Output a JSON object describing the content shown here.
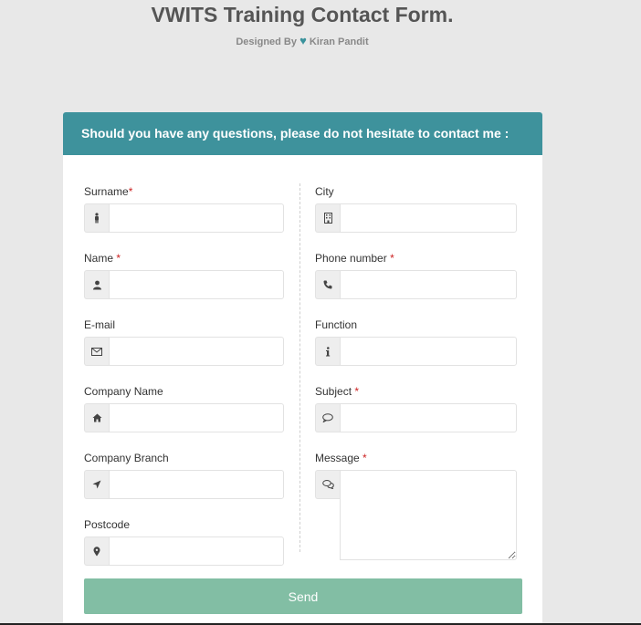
{
  "title": "VWITS Training Contact Form.",
  "subtitle": {
    "prefix": "Designed By",
    "heart_icon": "heart-icon",
    "author": "Kiran Pandit"
  },
  "form": {
    "header": "Should you have any questions, please do not hesitate to contact me :",
    "left_fields": [
      {
        "label": "Surname",
        "required": "*",
        "icon": "person-icon",
        "value": ""
      },
      {
        "label": "Name ",
        "required": "*",
        "icon": "user-icon",
        "value": ""
      },
      {
        "label": "E-mail",
        "required": "",
        "icon": "envelope-icon",
        "value": ""
      },
      {
        "label": "Company Name",
        "required": "",
        "icon": "home-icon",
        "value": ""
      },
      {
        "label": "Company Branch",
        "required": "",
        "icon": "location-arrow-icon",
        "value": ""
      },
      {
        "label": "Postcode",
        "required": "",
        "icon": "map-marker-icon",
        "value": ""
      }
    ],
    "right_fields": [
      {
        "label": "City",
        "required": "",
        "icon": "building-icon",
        "value": ""
      },
      {
        "label": "Phone number ",
        "required": "*",
        "icon": "phone-icon",
        "value": ""
      },
      {
        "label": "Function",
        "required": "",
        "icon": "info-icon",
        "value": ""
      },
      {
        "label": "Subject ",
        "required": "*",
        "icon": "speech-bubble-icon",
        "value": ""
      }
    ],
    "message": {
      "label": "Message ",
      "required": "*",
      "icon": "comments-icon",
      "value": ""
    },
    "send_label": "Send"
  },
  "colors": {
    "page_background": "#e8e8e8",
    "header_background": "#3e929c",
    "send_button": "#82bea4",
    "required_marker": "#cc2222"
  }
}
